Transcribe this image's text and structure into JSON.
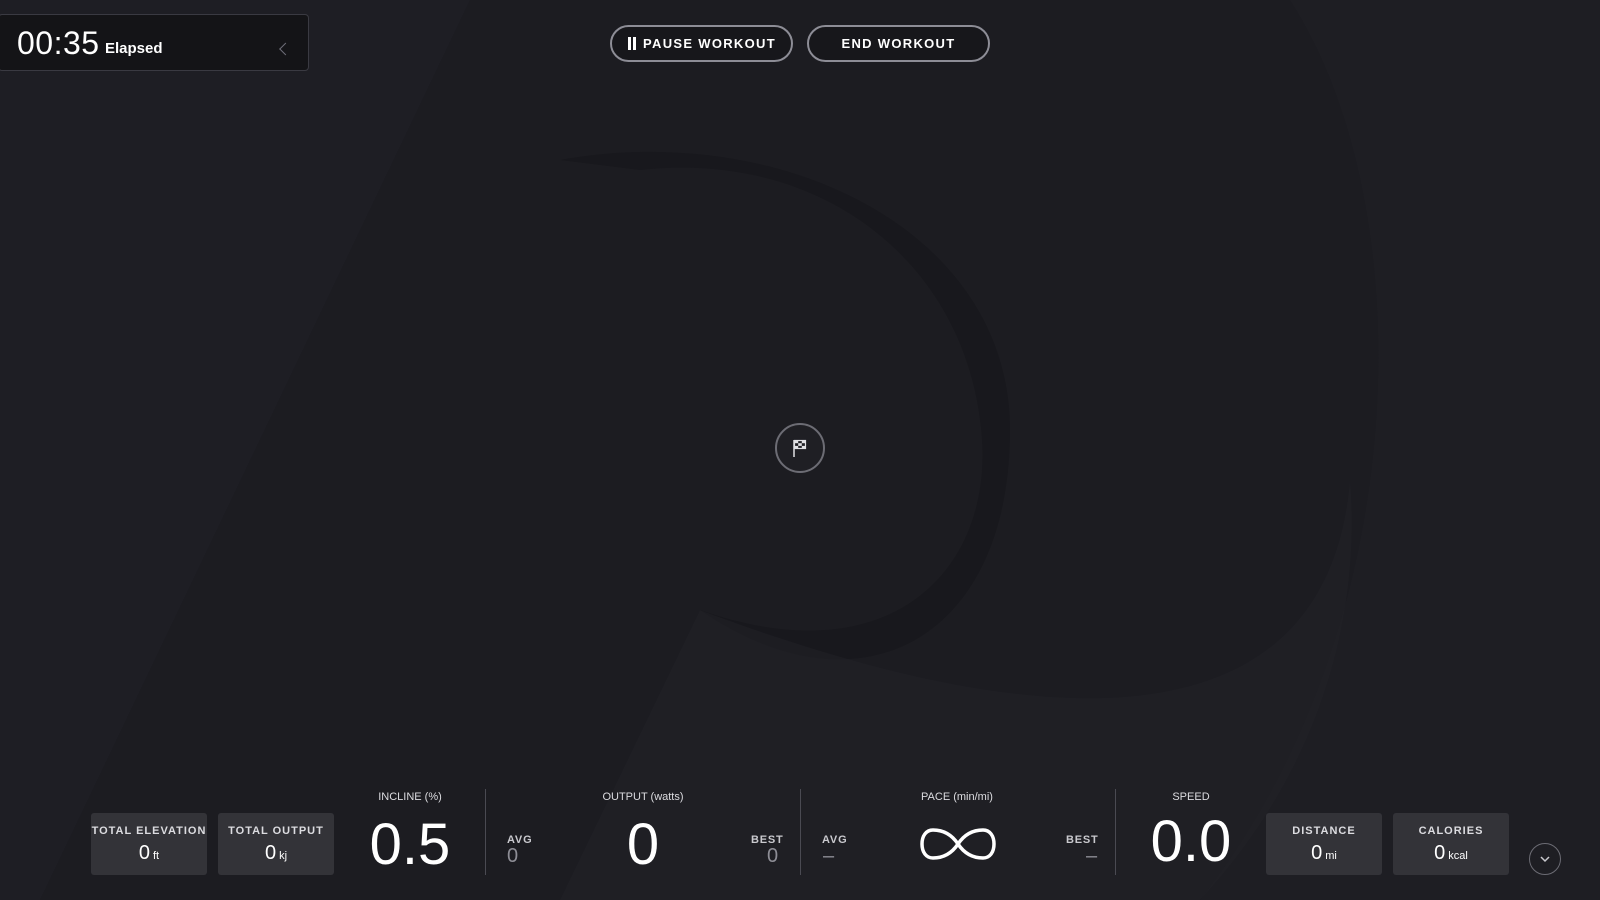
{
  "timer": {
    "value": "00:35",
    "label": "Elapsed"
  },
  "controls": {
    "pause_label": "PAUSE WORKOUT",
    "end_label": "END WORKOUT"
  },
  "icons": {
    "pause": "pause-icon",
    "flag": "checkered-flag-icon",
    "collapse": "chevron-left-icon",
    "expand": "chevron-down-icon",
    "pace": "infinity-icon"
  },
  "metrics": {
    "total_elevation": {
      "label": "TOTAL ELEVATION",
      "value": "0",
      "unit": "ft"
    },
    "total_output": {
      "label": "TOTAL OUTPUT",
      "value": "0",
      "unit": "kj"
    },
    "incline": {
      "label": "INCLINE (%)",
      "value": "0.5"
    },
    "output": {
      "label": "OUTPUT (watts)",
      "value": "0",
      "avg_label": "AVG",
      "avg_value": "0",
      "best_label": "BEST",
      "best_value": "0"
    },
    "pace": {
      "label": "PACE (min/mi)",
      "avg_label": "AVG",
      "avg_value": "–",
      "best_label": "BEST",
      "best_value": "–"
    },
    "speed": {
      "label": "SPEED",
      "value": "0.0"
    },
    "distance": {
      "label": "DISTANCE",
      "value": "0",
      "unit": "mi"
    },
    "calories": {
      "label": "CALORIES",
      "value": "0",
      "unit": "kcal"
    }
  },
  "colors": {
    "background": "#1c1c21",
    "panel": "#141417",
    "stat_box": "#333338",
    "button_border": "#8d8d96"
  }
}
